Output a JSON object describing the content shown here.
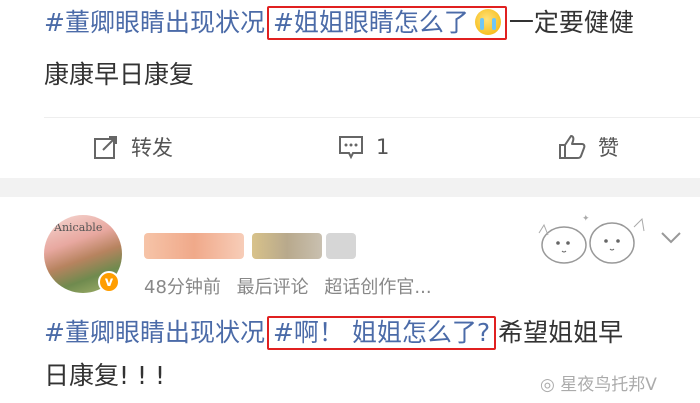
{
  "post1": {
    "tag": "#董卿眼睛出现状况",
    "highlight": "#姐姐眼睛怎么了",
    "emoji": "crying-face-icon",
    "text_after": "一定要健健",
    "line2": "康康早日康复"
  },
  "actions": {
    "repost_label": "转发",
    "comment_count": "1",
    "like_label": "赞"
  },
  "post2": {
    "avatar_text": "Anicable",
    "vbadge": "v",
    "time": "48分钟前",
    "latest_comment": "最后评论",
    "source": "超话创作官...",
    "tag": "#董卿眼睛出现状况",
    "highlight": "#啊！ 姐姐怎么了?",
    "text_after": "希望姐姐早",
    "line2": "日康复! ! !"
  },
  "watermark": "星夜鸟托邦V",
  "colors": {
    "tag_blue": "#4b6ba8",
    "highlight_red": "#e02020",
    "separator": "#f2f2f2",
    "meta_gray": "#888888"
  }
}
